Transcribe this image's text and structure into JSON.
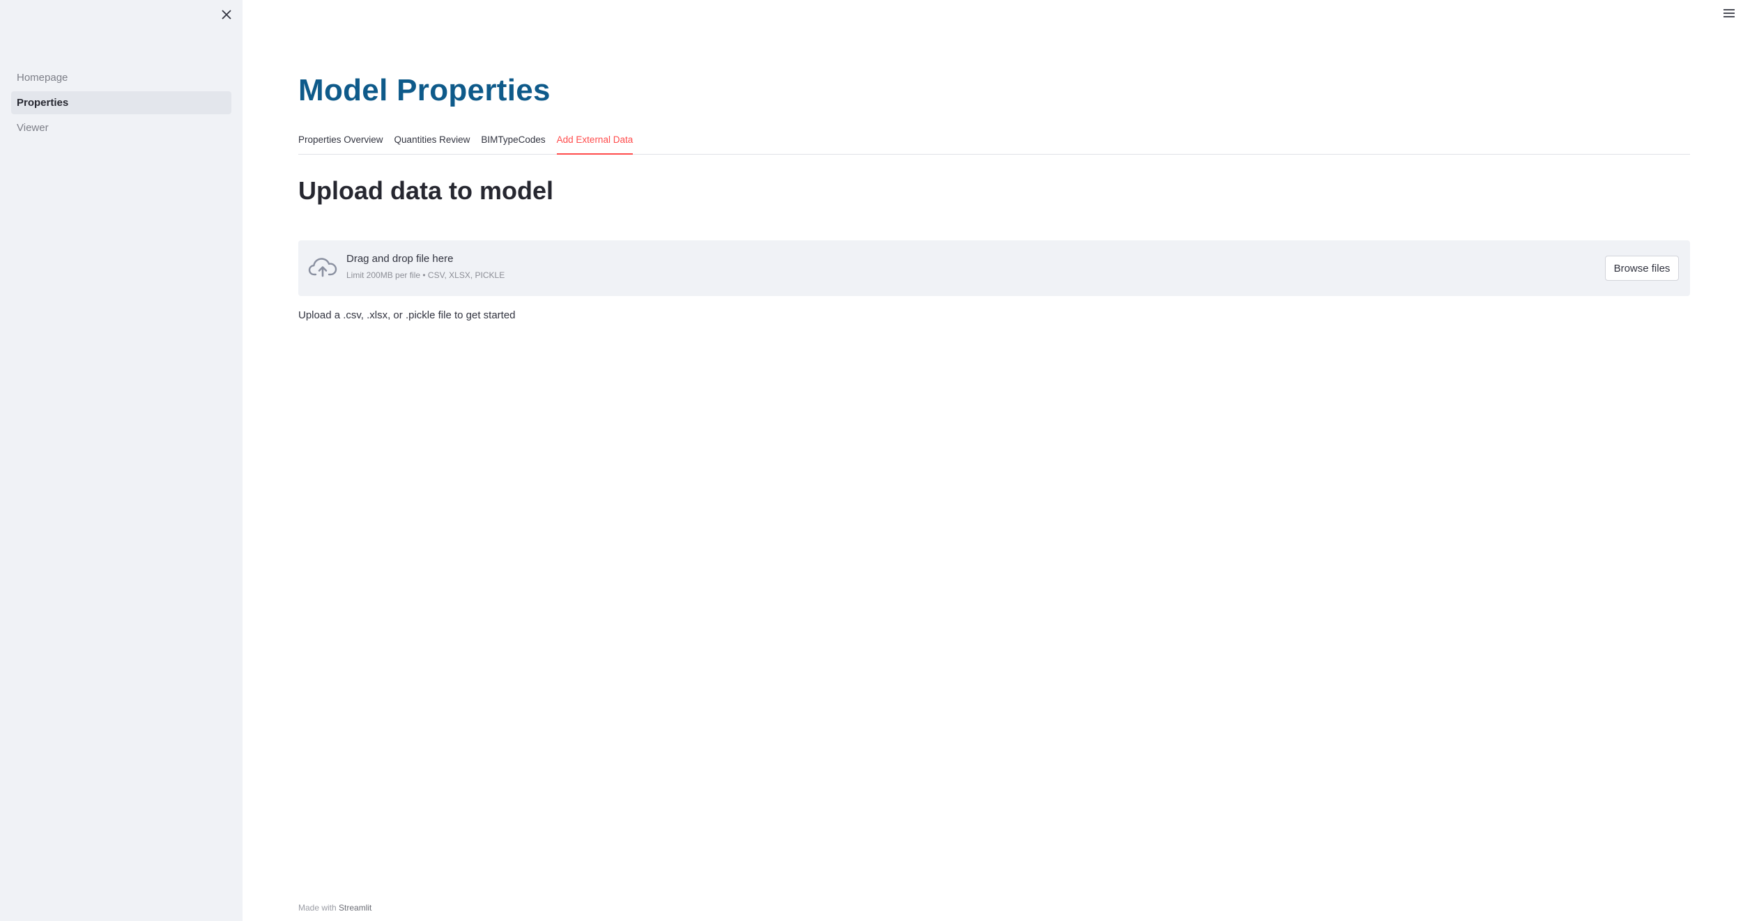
{
  "sidebar": {
    "items": [
      {
        "label": "Homepage",
        "active": false
      },
      {
        "label": "Properties",
        "active": true
      },
      {
        "label": "Viewer",
        "active": false
      }
    ],
    "close_icon": "close-icon"
  },
  "header": {
    "menu_icon": "hamburger-menu-icon"
  },
  "main": {
    "title": "Model Properties",
    "tabs": [
      {
        "label": "Properties Overview",
        "active": false
      },
      {
        "label": "Quantities Review",
        "active": false
      },
      {
        "label": "BIMTypeCodes",
        "active": false
      },
      {
        "label": "Add External Data",
        "active": true
      }
    ],
    "section_title": "Upload data to model",
    "uploader": {
      "title": "Drag and drop file here",
      "subtitle": "Limit 200MB per file • CSV, XLSX, PICKLE",
      "button_label": "Browse files",
      "icon": "cloud-upload-icon"
    },
    "info_text": "Upload a .csv, .xlsx, or .pickle file to get started"
  },
  "footer": {
    "prefix": "Made with",
    "brand": "Streamlit"
  },
  "colors": {
    "title": "#0e5a8a",
    "accent": "#ff4b4b",
    "sidebar_bg": "#f0f2f6"
  }
}
